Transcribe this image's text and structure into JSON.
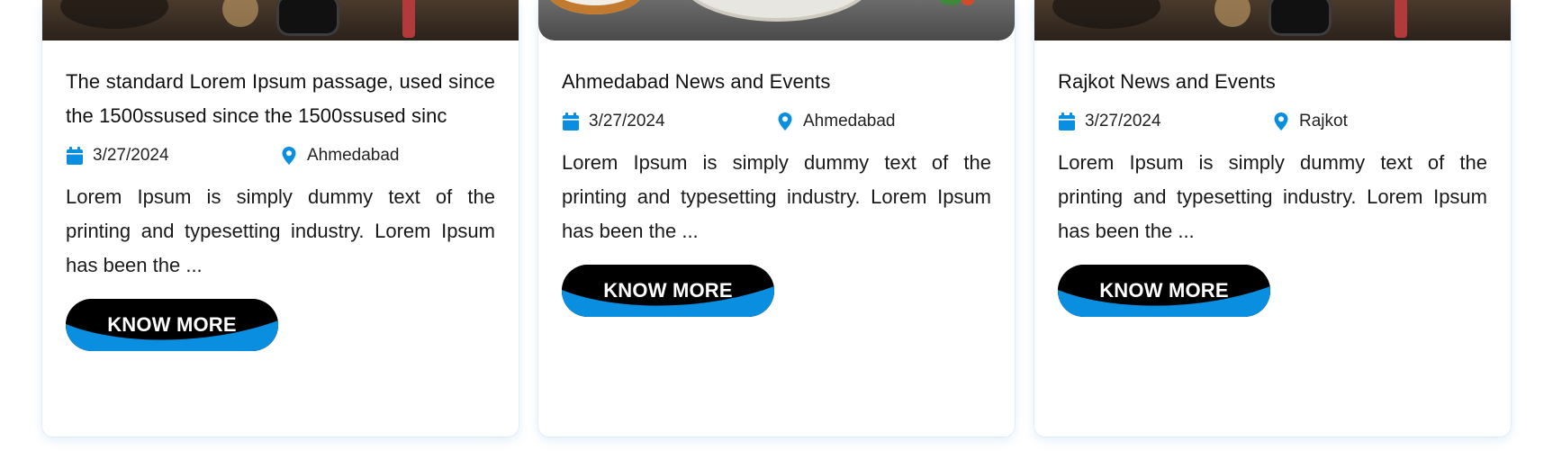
{
  "colors": {
    "accent": "#0a8fe0",
    "button_bg": "#000000",
    "text": "#111111"
  },
  "cards": [
    {
      "title": "The standard Lorem Ipsum passage, used since the 1500ssused since the 1500ssused sinc",
      "date": "3/27/2024",
      "location": "Ahmedabad",
      "excerpt": "Lorem Ipsum is simply dummy text of the printing and typesetting industry. Lorem Ipsum has been the ...",
      "button_label": "KNOW MORE",
      "date_icon": "calendar-icon",
      "location_icon": "map-pin-icon"
    },
    {
      "title": "Ahmedabad News and Events",
      "date": "3/27/2024",
      "location": "Ahmedabad",
      "excerpt": "Lorem Ipsum is simply dummy text of the printing and typesetting industry. Lorem Ipsum has been the ...",
      "button_label": "KNOW MORE",
      "date_icon": "calendar-icon",
      "location_icon": "map-pin-icon"
    },
    {
      "title": "Rajkot News and Events",
      "date": "3/27/2024",
      "location": "Rajkot",
      "excerpt": "Lorem Ipsum is simply dummy text of the printing and typesetting industry. Lorem Ipsum has been the ...",
      "button_label": "KNOW MORE",
      "date_icon": "calendar-icon",
      "location_icon": "map-pin-icon"
    }
  ]
}
